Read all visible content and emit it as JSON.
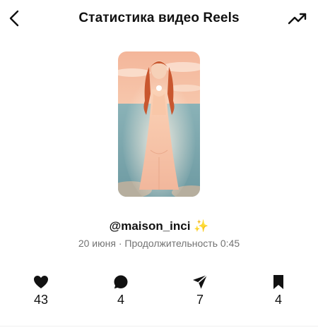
{
  "header": {
    "title": "Статистика видео Reels",
    "back_icon": "chevron-left-icon",
    "insights_icon": "trending-up-icon"
  },
  "reel": {
    "username": "@maison_inci",
    "sparkle": "✨",
    "date": "20 июня",
    "separator": "·",
    "duration_label": "Продолжительность",
    "duration": "0:45"
  },
  "stats": {
    "likes": "43",
    "comments": "4",
    "shares": "7",
    "saves": "4"
  },
  "colors": {
    "text": "#111111",
    "muted": "#737373",
    "sparkle": "#f5c542"
  }
}
